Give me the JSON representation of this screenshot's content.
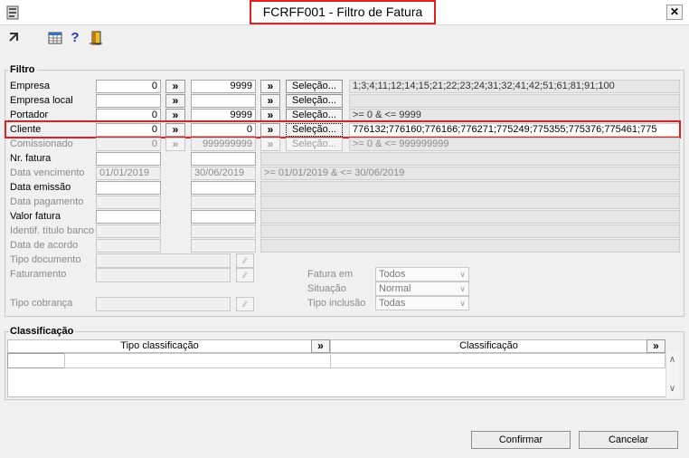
{
  "window": {
    "title": "FCRFF001 - Filtro de Fatura",
    "close": "✕"
  },
  "toolbar": {
    "icons": [
      "exit-icon",
      "grid-icon",
      "help-icon",
      "door-icon"
    ],
    "help_glyph": "?"
  },
  "filtro": {
    "legend": "Filtro",
    "arrow": "»",
    "selecao": "Seleção...",
    "rows": [
      {
        "label": "Empresa",
        "from": "0",
        "to": "9999",
        "info": "1;3;4;11;12;14;15;21;22;23;24;31;32;41;42;51;61;81;91;100"
      },
      {
        "label": "Empresa local",
        "from": "",
        "to": "",
        "info": ""
      },
      {
        "label": "Portador",
        "from": "0",
        "to": "9999",
        "info": ">= 0 & <= 9999"
      },
      {
        "label": "Cliente",
        "from": "0",
        "to": "0",
        "info": "776132;776160;776166;776271;775249;775355;775376;775461;775"
      },
      {
        "label": "Comissionado",
        "from": "0",
        "to": "999999999",
        "info": ">= 0 & <= 999999999"
      },
      {
        "label": "Nr. fatura",
        "from": "",
        "to": "",
        "info": ""
      },
      {
        "label": "Data vencimento",
        "from": "01/01/2019",
        "to": "30/06/2019",
        "info": ">= 01/01/2019 & <= 30/06/2019"
      },
      {
        "label": "Data emissão",
        "from": "",
        "to": "",
        "info": ""
      },
      {
        "label": "Data pagamento",
        "from": "",
        "to": "",
        "info": ""
      },
      {
        "label": "Valor fatura",
        "from": "",
        "to": "",
        "info": ""
      },
      {
        "label": "Identif. título banco",
        "from": "",
        "to": "",
        "info": ""
      },
      {
        "label": "Data de acordo",
        "from": "",
        "to": "",
        "info": ""
      }
    ],
    "tipo_documento": "Tipo documento",
    "faturamento": "Faturamento",
    "tipo_cobranca": "Tipo cobrança",
    "fatura_em": {
      "label": "Fatura em",
      "value": "Todos"
    },
    "situacao": {
      "label": "Situação",
      "value": "Normal"
    },
    "tipo_inclusao": {
      "label": "Tipo inclusão",
      "value": "Todas"
    }
  },
  "classificacao": {
    "legend": "Classificação",
    "col1": "Tipo classificação",
    "col2": "Classificação",
    "arrow": "»"
  },
  "buttons": {
    "confirm": "Confirmar",
    "cancel": "Cancelar"
  }
}
